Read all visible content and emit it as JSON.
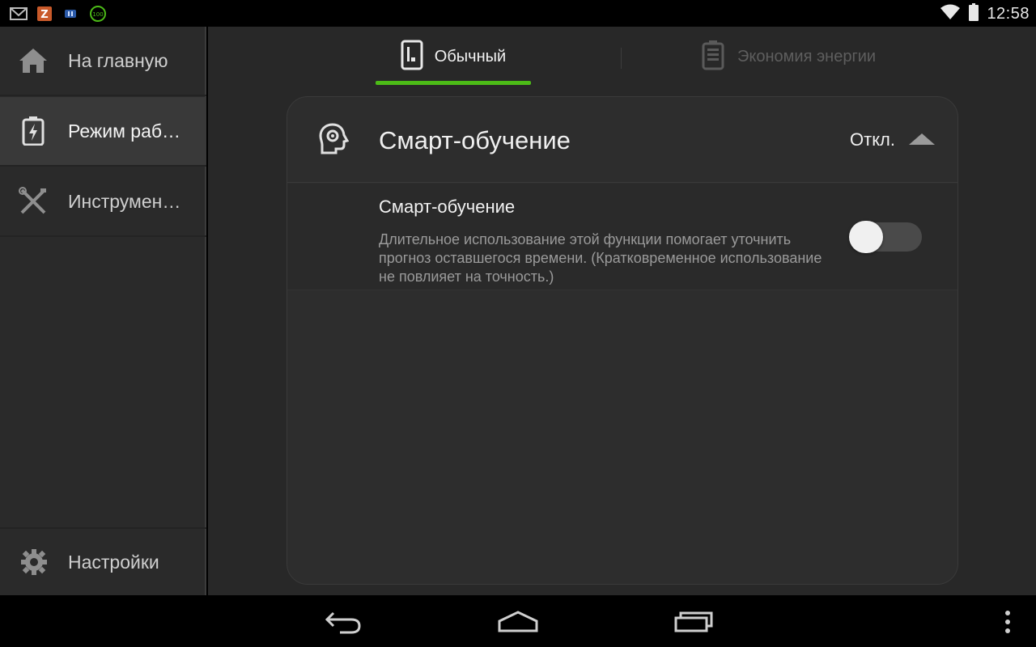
{
  "status_bar": {
    "time": "12:58",
    "notification_icons": [
      "gmail-icon",
      "z-app-icon",
      "app-icon",
      "battery-100-icon"
    ],
    "battery_badge": "100"
  },
  "sidebar": {
    "items": [
      {
        "label": "На главную",
        "icon": "home-icon",
        "selected": false
      },
      {
        "label": "Режим раб…",
        "icon": "battery-mode-icon",
        "selected": true
      },
      {
        "label": "Инструмен…",
        "icon": "tools-icon",
        "selected": false
      }
    ],
    "settings": {
      "label": "Настройки",
      "icon": "gear-icon"
    }
  },
  "tabs": [
    {
      "label": "Обычный",
      "icon": "phone-icon",
      "active": true
    },
    {
      "label": "Экономия энергии",
      "icon": "battery-icon",
      "active": false
    }
  ],
  "card": {
    "title": "Смарт-обучение",
    "state": "Откл.",
    "icon": "smart-learning-head-icon",
    "setting": {
      "title": "Смарт-обучение",
      "description": "Длительное использование этой функции помогает уточнить прогноз оставшегося времени. (Кратковременное использование не повлияет на точность.)",
      "enabled": false
    }
  },
  "colors": {
    "accent": "#4cbb17",
    "background": "#282828",
    "sidebar": "#2a2a2a"
  }
}
